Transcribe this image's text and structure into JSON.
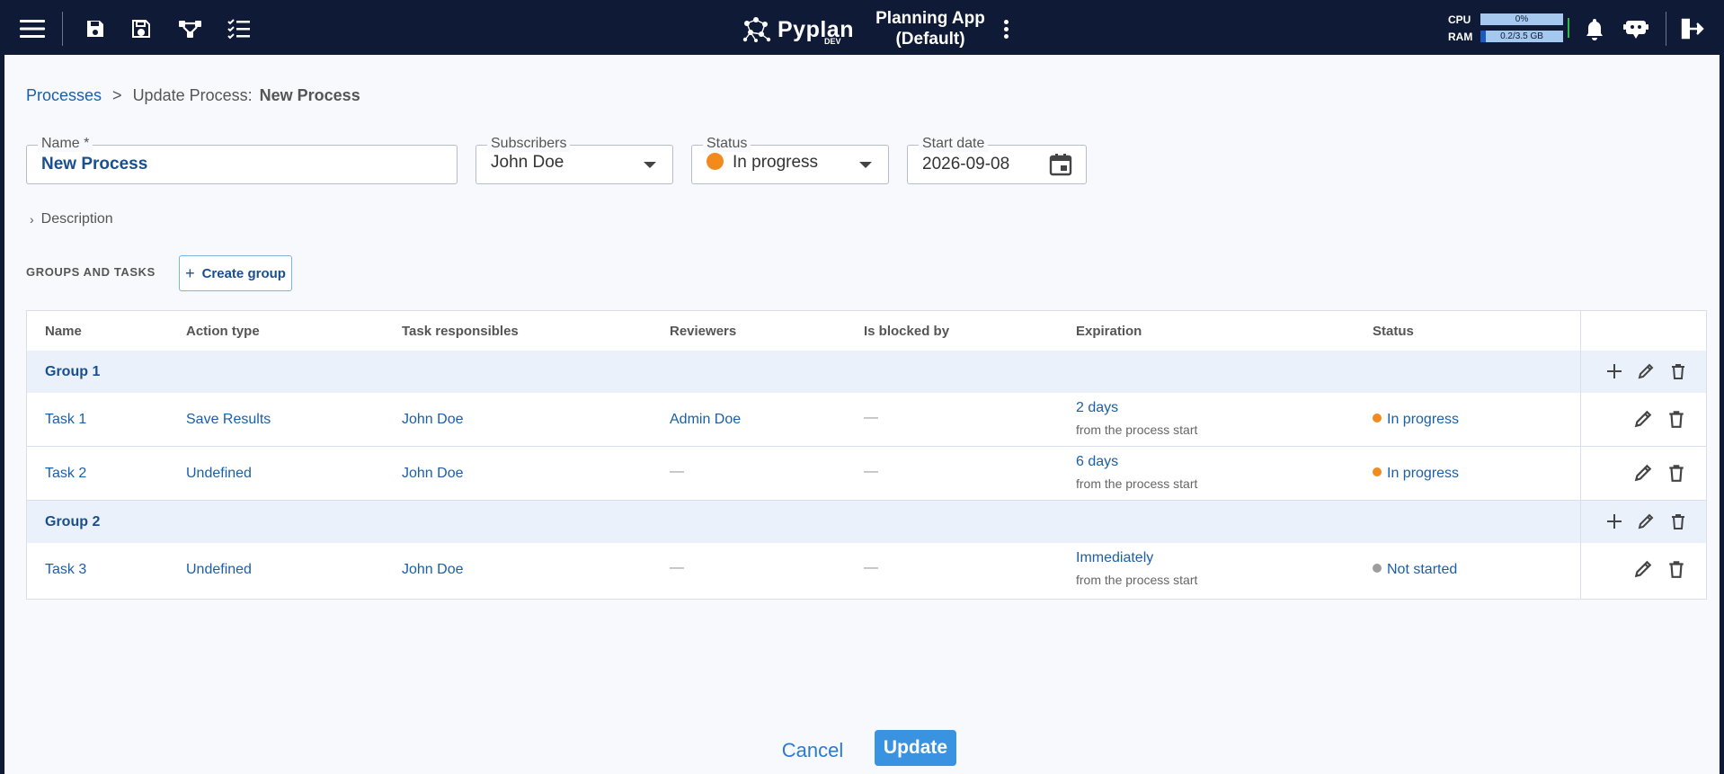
{
  "topbar": {
    "logo_text": "Pyplan",
    "logo_env": "DEV",
    "app_title_line1": "Planning App",
    "app_title_line2": "(Default)",
    "cpu_label": "CPU",
    "cpu_value": "0%",
    "cpu_fraction": 0.0,
    "ram_label": "RAM",
    "ram_value": "0.2/3.5 GB",
    "ram_fraction": 0.06,
    "icons": [
      "menu-icon",
      "save-icon",
      "save-as-icon",
      "flow-icon",
      "checklist-icon",
      "more-vert-icon",
      "bell-icon",
      "assistant-icon",
      "logout-icon"
    ],
    "bg_color": "#0f1a36"
  },
  "breadcrumb": {
    "root": "Processes",
    "separator": ">",
    "prefix": "Update Process:",
    "current": "New Process"
  },
  "form": {
    "name_label": "Name *",
    "name_value": "New Process",
    "subscribers_label": "Subscribers",
    "subscribers_value": "John Doe",
    "status_label": "Status",
    "status_value": "In progress",
    "start_date_label": "Start date",
    "start_date_value": "2026-09-08",
    "description_label": "Description"
  },
  "groups": {
    "title": "GROUPS AND TASKS",
    "create_label": "Create group"
  },
  "table": {
    "headers": [
      "Name",
      "Action type",
      "Task responsibles",
      "Reviewers",
      "Is blocked by",
      "Expiration",
      "Status"
    ],
    "dash": "—",
    "rows": [
      {
        "kind": "group",
        "name": "Group 1"
      },
      {
        "kind": "task",
        "name": "Task 1",
        "action_type": "Save Results",
        "responsibles": "John Doe",
        "reviewers": "Admin Doe",
        "blocked_by": "—",
        "expiration": "2 days",
        "expiration_sub": "from the process start",
        "status": "In progress",
        "status_color": "#f28a1e"
      },
      {
        "kind": "task",
        "name": "Task 2",
        "action_type": "Undefined",
        "responsibles": "John Doe",
        "reviewers": "—",
        "blocked_by": "—",
        "expiration": "6 days",
        "expiration_sub": "from the process start",
        "status": "In progress",
        "status_color": "#f28a1e"
      },
      {
        "kind": "group",
        "name": "Group 2"
      },
      {
        "kind": "task",
        "name": "Task 3",
        "action_type": "Undefined",
        "responsibles": "John Doe",
        "reviewers": "—",
        "blocked_by": "—",
        "expiration": "Immediately",
        "expiration_sub": "from the process start",
        "status": "Not started",
        "status_color": "#9e9e9e"
      }
    ]
  },
  "footer": {
    "cancel_label": "Cancel",
    "update_label": "Update"
  },
  "colors": {
    "link": "#1a5fa8",
    "primary_button": "#3a93e0",
    "group_row_bg": "#eaf1fb",
    "in_progress": "#f28a1e",
    "not_started": "#9e9e9e"
  }
}
